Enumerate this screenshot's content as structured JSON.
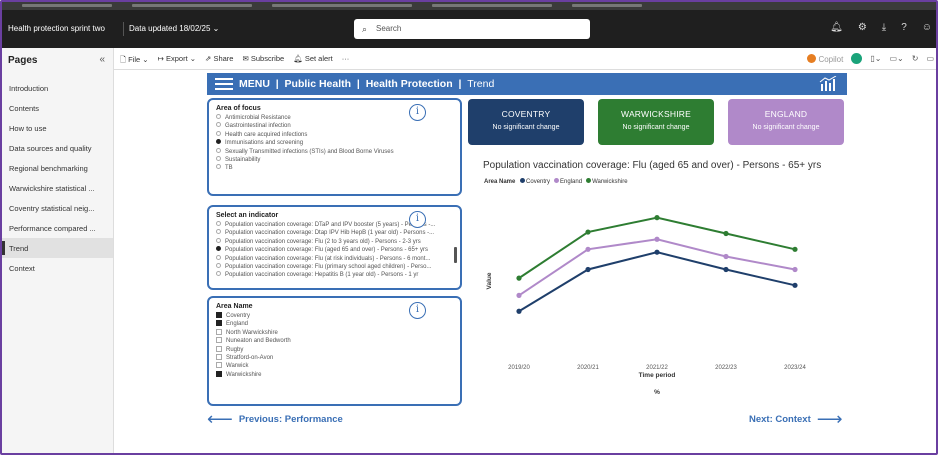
{
  "topbar": {
    "workspace": "Health protection sprint two",
    "data_updated": "Data updated 18/02/25",
    "search_placeholder": "Search"
  },
  "pages_panel": {
    "title": "Pages",
    "items": [
      {
        "label": "Introduction",
        "active": false
      },
      {
        "label": "Contents",
        "active": false
      },
      {
        "label": "How to use",
        "active": false
      },
      {
        "label": "Data sources and quality",
        "active": false
      },
      {
        "label": "Regional benchmarking",
        "active": false
      },
      {
        "label": "Warwickshire statistical ...",
        "active": false
      },
      {
        "label": "Coventry statistical neig...",
        "active": false
      },
      {
        "label": "Performance compared ...",
        "active": false
      },
      {
        "label": "Trend",
        "active": true
      },
      {
        "label": "Context",
        "active": false
      }
    ]
  },
  "toolbar": {
    "file": "File",
    "export": "Export",
    "share": "Share",
    "subscribe": "Subscribe",
    "set_alert": "Set alert",
    "more": "···",
    "copilot": "Copilot"
  },
  "banner": {
    "menu": "MENU",
    "crumb1": "Public Health",
    "crumb2": "Health Protection",
    "crumb3": "Trend"
  },
  "area_of_focus": {
    "title": "Area of focus",
    "options": [
      {
        "label": "Antimicrobial Resistance",
        "selected": false
      },
      {
        "label": "Gastrointestinal infection",
        "selected": false
      },
      {
        "label": "Health care acquired infections",
        "selected": false
      },
      {
        "label": "Immunisations and screening",
        "selected": true
      },
      {
        "label": "Sexually Transmitted infections (STIs) and Blood Borne Viruses",
        "selected": false
      },
      {
        "label": "Sustainability",
        "selected": false
      },
      {
        "label": "TB",
        "selected": false
      }
    ]
  },
  "indicator": {
    "title": "Select an indicator",
    "options": [
      {
        "label": "Population vaccination coverage: DTaP and IPV booster (5 years) - Persons -...",
        "selected": false
      },
      {
        "label": "Population vaccination coverage: Dtap IPV Hib HepB (1 year old) - Persons -...",
        "selected": false
      },
      {
        "label": "Population vaccination coverage: Flu (2 to 3 years old) - Persons - 2-3 yrs",
        "selected": false
      },
      {
        "label": "Population vaccination coverage: Flu (aged 65 and over) - Persons - 65+ yrs",
        "selected": true
      },
      {
        "label": "Population vaccination coverage: Flu (at risk individuals) - Persons - 6 mont...",
        "selected": false
      },
      {
        "label": "Population vaccination coverage: Flu (primary school aged children) - Perso...",
        "selected": false
      },
      {
        "label": "Population vaccination coverage: Hepatitis B (1 year old) - Persons - 1 yr",
        "selected": false
      }
    ]
  },
  "area_name": {
    "title": "Area Name",
    "options": [
      {
        "label": "Coventry",
        "checked": true
      },
      {
        "label": "England",
        "checked": true
      },
      {
        "label": "North Warwickshire",
        "checked": false
      },
      {
        "label": "Nuneaton and Bedworth",
        "checked": false
      },
      {
        "label": "Rugby",
        "checked": false
      },
      {
        "label": "Stratford-on-Avon",
        "checked": false
      },
      {
        "label": "Warwick",
        "checked": false
      },
      {
        "label": "Warwickshire",
        "checked": true
      }
    ]
  },
  "cards": [
    {
      "name": "COVENTRY",
      "status": "No significant change",
      "color": "#1f3f6b"
    },
    {
      "name": "WARWICKSHIRE",
      "status": "No significant change",
      "color": "#2e7d32"
    },
    {
      "name": "ENGLAND",
      "status": "No significant change",
      "color": "#b089c9"
    }
  ],
  "chart_data": {
    "type": "line",
    "title": "Population vaccination coverage: Flu (aged 65 and over) - Persons - 65+ yrs",
    "legend_title": "Area Name",
    "legend_position": "top-left",
    "xlabel": "Time period",
    "ylabel": "Value",
    "footer": "%",
    "categories": [
      "2019/20",
      "2020/21",
      "2021/22",
      "2022/23",
      "2023/24"
    ],
    "ylim": [
      0,
      100
    ],
    "grid": false,
    "series": [
      {
        "name": "Coventry",
        "color": "#1f3f6b",
        "values": [
          29,
          58,
          70,
          58,
          47
        ]
      },
      {
        "name": "England",
        "color": "#b089c9",
        "values": [
          40,
          72,
          79,
          67,
          58
        ]
      },
      {
        "name": "Warwickshire",
        "color": "#2e7d32",
        "values": [
          52,
          84,
          94,
          83,
          72
        ]
      }
    ]
  },
  "nav": {
    "prev": "Previous: Performance",
    "next": "Next: Context"
  }
}
